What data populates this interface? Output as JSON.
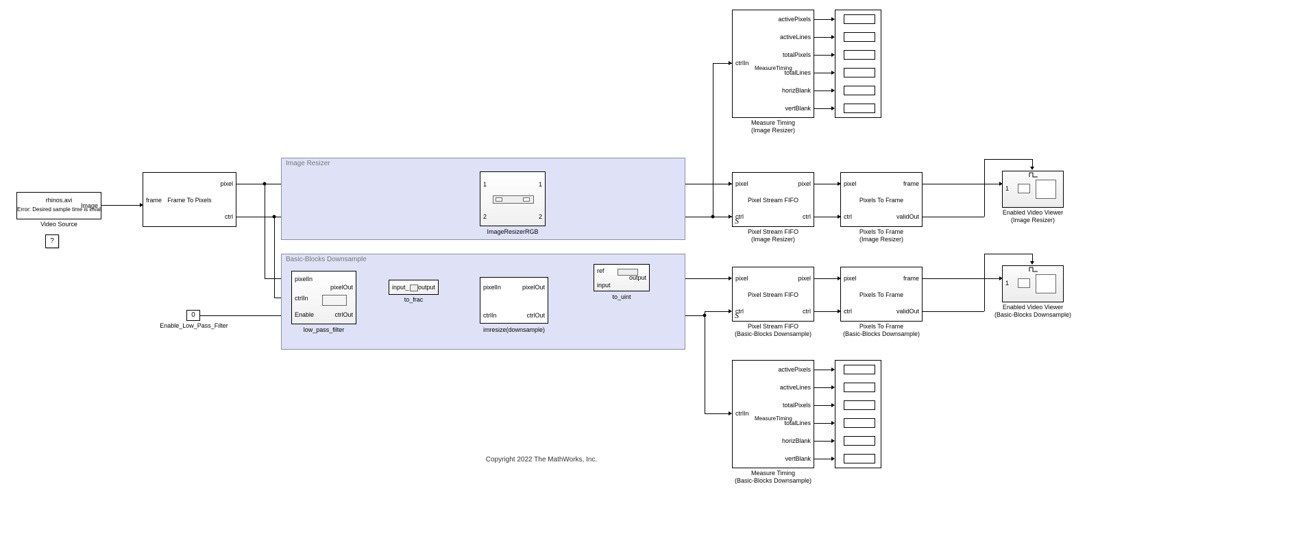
{
  "videoSource": {
    "line1": "rhinos.avi",
    "line2": "Error: Desired sample time is invalid",
    "port": "Image",
    "caption": "Video Source"
  },
  "hintBlock": {
    "label": "?"
  },
  "frameToPixels": {
    "in": "frame",
    "center": "Frame To Pixels",
    "outTop": "pixel",
    "outBot": "ctrl"
  },
  "subsys1": {
    "title": "Image Resizer"
  },
  "subsys2": {
    "title": "Basic-Blocks Downsample"
  },
  "imgResizer": {
    "in1": "1",
    "in2": "2",
    "out1": "1",
    "out2": "2",
    "caption": "ImageResizerRGB"
  },
  "lowPass": {
    "in1": "pixelIn",
    "in2": "ctrlIn",
    "in3": "Enable",
    "out1": "pixelOut",
    "out2": "ctrlOut",
    "caption": "low_pass_filter"
  },
  "toFrac": {
    "in": "input_",
    "out": "output",
    "caption": "to_frac"
  },
  "imresize": {
    "in1": "pixelIn",
    "out1": "pixelOut",
    "in2": "ctrlIn",
    "out2": "ctrlOut",
    "caption": "imresize(downsample)"
  },
  "toUint": {
    "in1": "ref",
    "in2": "input",
    "out": "output",
    "caption": "to_uint"
  },
  "constBlock": {
    "value": "0",
    "caption": "Enable_Low_Pass_Filter"
  },
  "measureTiming": {
    "in": "ctrlIn",
    "center": "MeasureTiming",
    "o1": "activePixels",
    "o2": "activeLines",
    "o3": "totalPixels",
    "o4": "totalLines",
    "o5": "horizBlank",
    "o6": "vertBlank",
    "caption1": "Measure Timing",
    "sub1": "(Image Resizer)",
    "sub2": "(Basic-Blocks Downsample)"
  },
  "fifo": {
    "in1": "pixel",
    "out1": "pixel",
    "in2": "ctrl",
    "out2": "ctrl",
    "center": "Pixel Stream FIFO",
    "caption": "Pixel Stream FIFO",
    "sub1": "(Image Resizer)",
    "sub2": "(Basic-Blocks Downsample)"
  },
  "ptf": {
    "in1": "pixel",
    "out1": "frame",
    "in2": "ctrl",
    "out2": "validOut",
    "center": "Pixels To Frame",
    "caption": "Pixels To Frame",
    "sub1": "(Image Resizer)",
    "sub2": "(Basic-Blocks Downsample)"
  },
  "viewer": {
    "port": "1",
    "caption": "Enabled Video Viewer",
    "sub1": "(Image Resizer)",
    "sub2": "(Basic-Blocks Downsample)"
  },
  "copyright": "Copyright 2022 The MathWorks, Inc."
}
